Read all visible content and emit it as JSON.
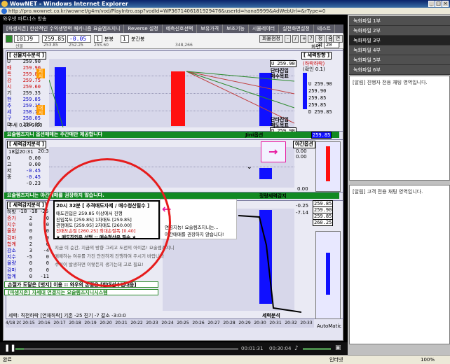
{
  "window": {
    "title": "WowNET - Windows Internet Explorer",
    "url": "http://pro.wownet.co.kr/wownet/g4m/vod/PlayIntro.asp?vodId=WP3671406181929476&userId=hana9999&AdWebUrl=&rType=0",
    "frame_title": "와우넷 파트너스 방송"
  },
  "app_tabs": [
    "[파생지존] 한산적인 수익생명력 패키니즘 요술멤즈지니",
    "Reverse 설정",
    "예측신호선택",
    "보유가격",
    "보조기능",
    "시뮬레이터",
    "실전화면설정",
    "테스트"
  ],
  "toolbar": {
    "code": "101J9",
    "price": "259.85",
    "change": "-0.05",
    "interval": "1",
    "interval_unit": "분봉",
    "count": "1",
    "count_unit": "분간봉",
    "sub_labels": [
      "선물",
      "253.85",
      "252.25",
      "255.60",
      "348,266"
    ],
    "menu": [
      "화물점정",
      "-",
      "/",
      "+",
      "?",
      "정확",
      "숨",
      "연결"
    ],
    "screen_label": "화면",
    "screen_value": "20"
  },
  "top_panel": {
    "title": "[ 선물지수분석 ]",
    "rows": [
      {
        "k": "U",
        "v": "259.90"
      },
      {
        "k": "매",
        "v": "259.90"
      },
      {
        "k": "특",
        "v": "259.85"
      },
      {
        "k": "강",
        "v": "259.75"
      },
      {
        "k": "시",
        "v": "259.60"
      },
      {
        "k": "기",
        "v": "259.35"
      },
      {
        "k": "현",
        "v": "259.85"
      },
      {
        "k": "추",
        "v": "259.15"
      },
      {
        "k": "세",
        "v": "258.75"
      },
      {
        "k": "구",
        "v": "258.05"
      },
      {
        "k": "D",
        "v": "259.85"
      }
    ],
    "tags": [
      "지시",
      "대시"
    ],
    "bottom_label": "추세 0.10  0.10",
    "right_title": "[ 세력방향 ]",
    "right_sub": "(하락하락)",
    "right_sub2": "(확인 0.1)",
    "right_rows": [
      "U 259.90",
      "259.90",
      "259.85",
      "259.85",
      "D 259.85"
    ],
    "mid_labels": [
      "U 259.90",
      "단타진입",
      "매수목표"
    ],
    "mid_labels2": [
      "단타진입",
      "매도목표",
      "D 259.90"
    ],
    "bottom_right": "259.85",
    "footer_msg": "요술렘즈지니 옵션매매는 주간매만 제공합니다",
    "footer_right": "Jini옵션"
  },
  "mid_panel": {
    "title": "[ 세력감지분석 ]",
    "time_row": [
      "18일20:31",
      "20:32"
    ],
    "rows": [
      {
        "k": "0",
        "v": "0.00"
      },
      {
        "k": "고",
        "v": "0.00"
      },
      {
        "k": "저",
        "v": "-0.45"
      },
      {
        "k": "종",
        "v": "-0.45"
      },
      {
        "k": "",
        "v": "-0.23"
      }
    ],
    "right_title": "야간옵션",
    "right_values": [
      "0.00",
      "0.00"
    ],
    "right_bottom": "0.00",
    "footer_msg": "요술렘즈지니는 야간매매를 권장하지 않습니다.",
    "footer_right": "정량세력감지"
  },
  "bottom_panel": {
    "title": "[ 세력감지분석 ]",
    "header": [
      "하방",
      "-18",
      "-18",
      "-25"
    ],
    "rows": [
      {
        "k": "증가",
        "a": "2",
        "b": "0"
      },
      {
        "k": "지수",
        "a": "0",
        "b": "0"
      },
      {
        "k": "물량",
        "a": "0",
        "b": "0"
      },
      {
        "k": "감마",
        "a": "0",
        "b": "0"
      },
      {
        "k": "합계",
        "a": "2",
        "b": "0"
      },
      {
        "k": "감소",
        "a": "3",
        "b": "-4"
      },
      {
        "k": "지수",
        "a": "-5",
        "b": "0"
      },
      {
        "k": "물량",
        "a": "0",
        "b": "0"
      },
      {
        "k": "감마",
        "a": "0",
        "b": "0"
      },
      {
        "k": "합계",
        "a": "0",
        "b": "-11"
      }
    ],
    "values_right": [
      "-0.25",
      "-7.14"
    ],
    "right_prices": [
      "259.85",
      "259.90",
      "259.85",
      "260.25"
    ],
    "footer1": "손절가 도달은 [벗지] 이용 :: 와우의 손절은 [한대선수법대응]",
    "footer2": "[파생지존] 자세대 연결지는 요술렘즈지니시스템",
    "status_row": "세력: 직전하락 [연재하락] 기존 -25 진기 -7   갈소 -3:0:0",
    "status_right": "세력분석",
    "automatic": "AutoMatic"
  },
  "popup": {
    "header": "20시 32분  [ 추격매도자제 / 매수청산필수 ]",
    "lines": [
      "매도진입은 259.85 이상에서 진행",
      "진입목도 [259.85]      1차매도 [259.85]",
      "관점매도 [259.95]      2차매도 [260.00]",
      "진매도손절 [260.25]   최대손절폭 [0.40]",
      "★ 매도진입은 선택 :: 매수청산은 필수 ★"
    ]
  },
  "notes": {
    "right1": "연공지능! 요술렘즈지니는...",
    "right2": "야간매매를 권장하지 않습니다!",
    "left1": "지금 이 순간, 지금의 방향 그리고 도전의 아이콘! 요술렘즈지니",
    "left2": "매매하는 여유를 가진 안전하게 진행하여 주시기 바랍니다",
    "left3": "수익이 발생하면 이렇든지 생기는데 고로 필요! "
  },
  "time_axis": [
    "4/18 20:14",
    "20:15",
    "20:16",
    "20:17",
    "20:18",
    "20:19",
    "20:20",
    "20:21",
    "20:22",
    "20:23",
    "20:24",
    "20:25",
    "20:26",
    "20:27",
    "20:28",
    "20:29",
    "20:30",
    "20:31",
    "20:32",
    "20:33"
  ],
  "player": {
    "elapsed": "00:01:31",
    "total": "00:30:04"
  },
  "status": {
    "left": "완료",
    "zone": "인터넷",
    "zoom": "100%"
  },
  "right_sidebar": {
    "tabs": [
      "녹화파일 1부",
      "녹화파일 2부",
      "녹화파일 3부",
      "녹화파일 4부",
      "녹화파일 5부",
      "녹화파일 6부"
    ],
    "active_tab": 2,
    "panel1": "[알림] 진행자 전용 채팅 영역입니다.",
    "panel2": "[알림] 고객 전용 채팅 영역입니다."
  },
  "colors": {
    "red_bar": "#ff1010",
    "blue_bar": "#1010ff",
    "ellipse": "#e61c1c",
    "arrow": "#e81aa0",
    "green_msg": "#128a23"
  }
}
